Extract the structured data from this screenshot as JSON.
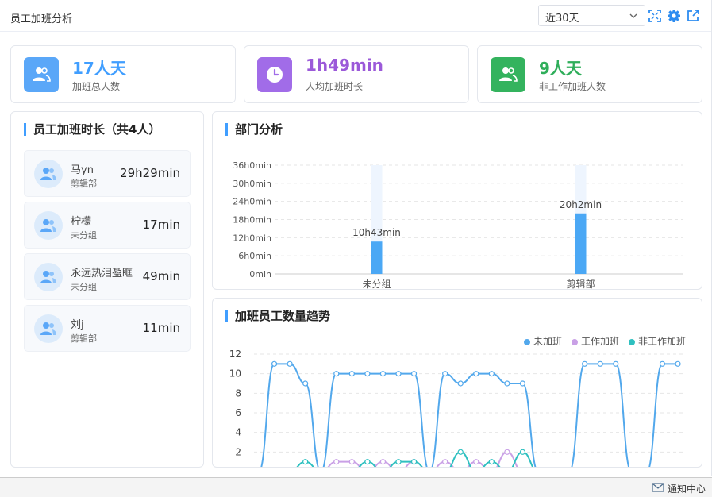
{
  "header": {
    "title": "员工加班分析",
    "range_value": "近30天"
  },
  "stats": [
    {
      "value": "17人天",
      "label": "加班总人数",
      "color": "#409eff",
      "icon_bg": "#5aa7f8"
    },
    {
      "value": "1h49min",
      "label": "人均加班时长",
      "color": "#9b59d9",
      "icon_bg": "#a16ce8"
    },
    {
      "value": "9人天",
      "label": "非工作加班人数",
      "color": "#2fae5a",
      "icon_bg": "#34b35e"
    }
  ],
  "employees": {
    "title": "员工加班时长（共4人）",
    "list": [
      {
        "name": "马yn",
        "dept": "剪辑部",
        "duration": "29h29min"
      },
      {
        "name": "柠檬",
        "dept": "未分组",
        "duration": "17min"
      },
      {
        "name": "永远热泪盈眶",
        "dept": "未分组",
        "duration": "49min"
      },
      {
        "name": "刘j",
        "dept": "剪辑部",
        "duration": "11min"
      }
    ]
  },
  "dept_chart": {
    "title": "部门分析",
    "chart_data": {
      "type": "bar",
      "categories": [
        "未分组",
        "剪辑部"
      ],
      "values": [
        643,
        1202
      ],
      "value_labels": [
        "10h43min",
        "20h2min"
      ],
      "ylim": [
        0,
        2160
      ],
      "yticks": [
        0,
        360,
        720,
        1080,
        1440,
        1800,
        2160
      ],
      "ytick_labels": [
        "0min",
        "6h0min",
        "12h0min",
        "18h0min",
        "24h0min",
        "30h0min",
        "36h0min"
      ],
      "bar_color": "#4ba8f5",
      "background_bar_color": "#eef5fe",
      "grid": true
    }
  },
  "trend_chart": {
    "title": "加班员工数量趋势",
    "chart_data": {
      "type": "line",
      "ylim": [
        0,
        12
      ],
      "yticks": [
        2,
        4,
        6,
        8,
        10,
        12
      ],
      "series": [
        {
          "name": "未加班",
          "color": "#52a8ec",
          "values": [
            0,
            11,
            11,
            9,
            0,
            10,
            10,
            10,
            10,
            10,
            10,
            0,
            10,
            9,
            10,
            10,
            9,
            9,
            0,
            0,
            0,
            11,
            11,
            11,
            0,
            0,
            11,
            11
          ]
        },
        {
          "name": "工作加班",
          "color": "#c9a0e6",
          "values": [
            0,
            0,
            0,
            0,
            0,
            1,
            1,
            0,
            1,
            0,
            1,
            0,
            1,
            0,
            1,
            0,
            2,
            0,
            0,
            0,
            0,
            0,
            0,
            0,
            0,
            0,
            0,
            0
          ]
        },
        {
          "name": "非工作加班",
          "color": "#2fc0c0",
          "values": [
            0,
            0,
            0,
            1,
            0,
            0,
            0,
            1,
            0,
            1,
            1,
            0,
            0,
            2,
            0,
            1,
            0,
            2,
            0,
            0,
            0,
            0,
            0,
            0,
            0,
            0,
            0,
            0
          ]
        }
      ],
      "legend": "top-right",
      "grid": true
    }
  },
  "statusbar": {
    "notify_label": "通知中心"
  }
}
